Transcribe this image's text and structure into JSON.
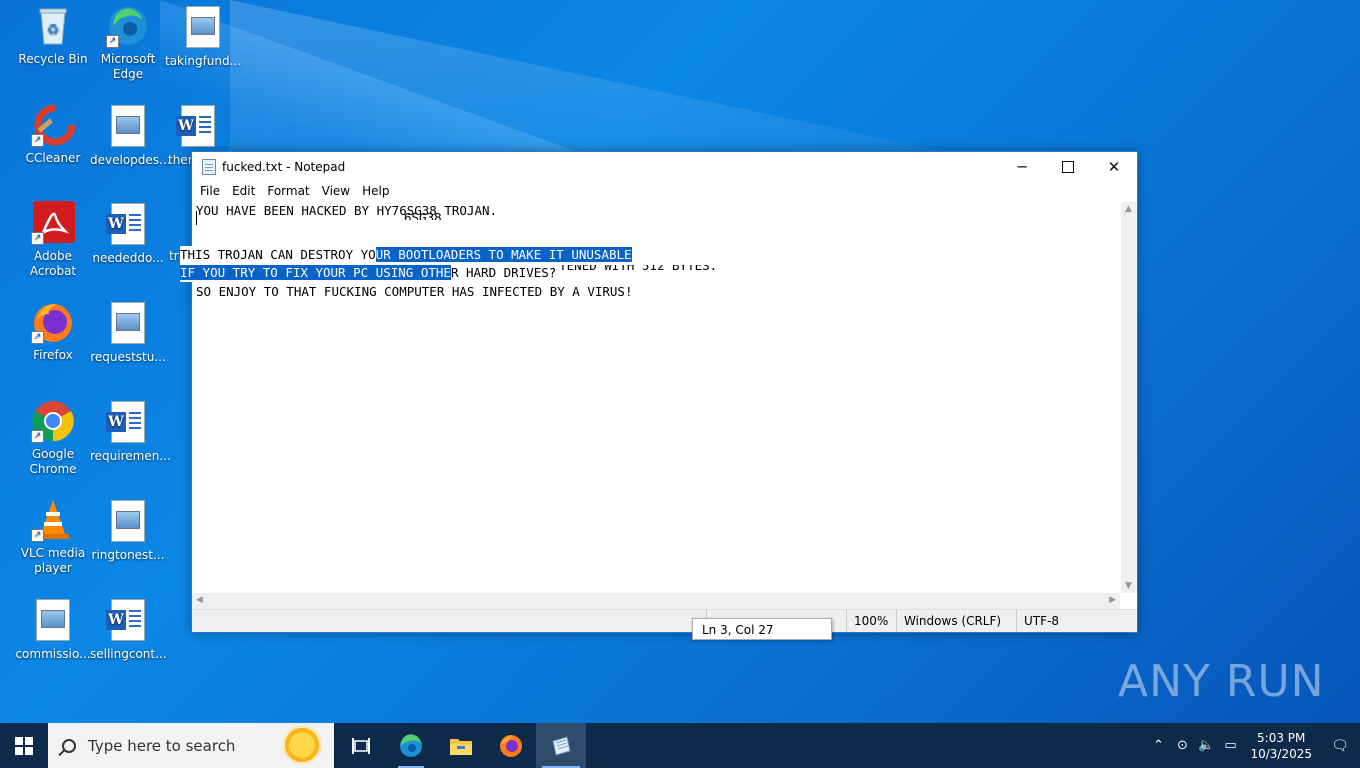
{
  "desktop": {
    "icons": [
      {
        "label": "Recycle Bin"
      },
      {
        "label": "Microsoft Edge"
      },
      {
        "label": "takingfund..."
      },
      {
        "label": "CCleaner"
      },
      {
        "label": "developdes..."
      },
      {
        "label": "ther"
      },
      {
        "label": "Adobe Acrobat"
      },
      {
        "label": "neededdo..."
      },
      {
        "label": "tr"
      },
      {
        "label": "Firefox"
      },
      {
        "label": "requeststu..."
      },
      {
        "label": "Google Chrome"
      },
      {
        "label": "requiremen..."
      },
      {
        "label": "VLC media player"
      },
      {
        "label": "ringtonest..."
      },
      {
        "label": "commissio..."
      },
      {
        "label": "sellingcont..."
      }
    ]
  },
  "notepad": {
    "title": "fucked.txt - Notepad",
    "menu": [
      "File",
      "Edit",
      "Format",
      "View",
      "Help"
    ],
    "lines": {
      "l1": "YOU HAVE BEEN HACKED BY HY76SG38 TROJAN.",
      "l2_fragment": "6SG38",
      "l3_unsel": "THIS TROJAN CAN DESTROY YO",
      "l3_sel": "UR BOOTLOADERS TO MAKE IT UNUSABLE",
      "l4_sel": "IF YOU TRY TO FIX YOUR PC USING OTHE",
      "l4_unsel": "R HARD DRIVES?",
      "l5": "YOU CANT BECAUSE THE HARDDRIVES ARE OVERWRITTENED WITH 512 BYTES.",
      "l6": "SO ENJOY TO THAT FUCKING COMPUTER HAS INFECTED BY A VIRUS!"
    },
    "status": {
      "zoom": "100%",
      "line_ending": "Windows (CRLF)",
      "encoding": "UTF-8"
    },
    "tooltip": "Ln 3, Col 27"
  },
  "taskbar": {
    "search_placeholder": "Type here to search",
    "time": "5:03 PM",
    "date": "10/3/2025"
  },
  "watermark": "ANY RUN",
  "colors": {
    "desktop": "#0a78dc",
    "selection": "#0a64c8",
    "taskbar": "#0d2a4a"
  }
}
